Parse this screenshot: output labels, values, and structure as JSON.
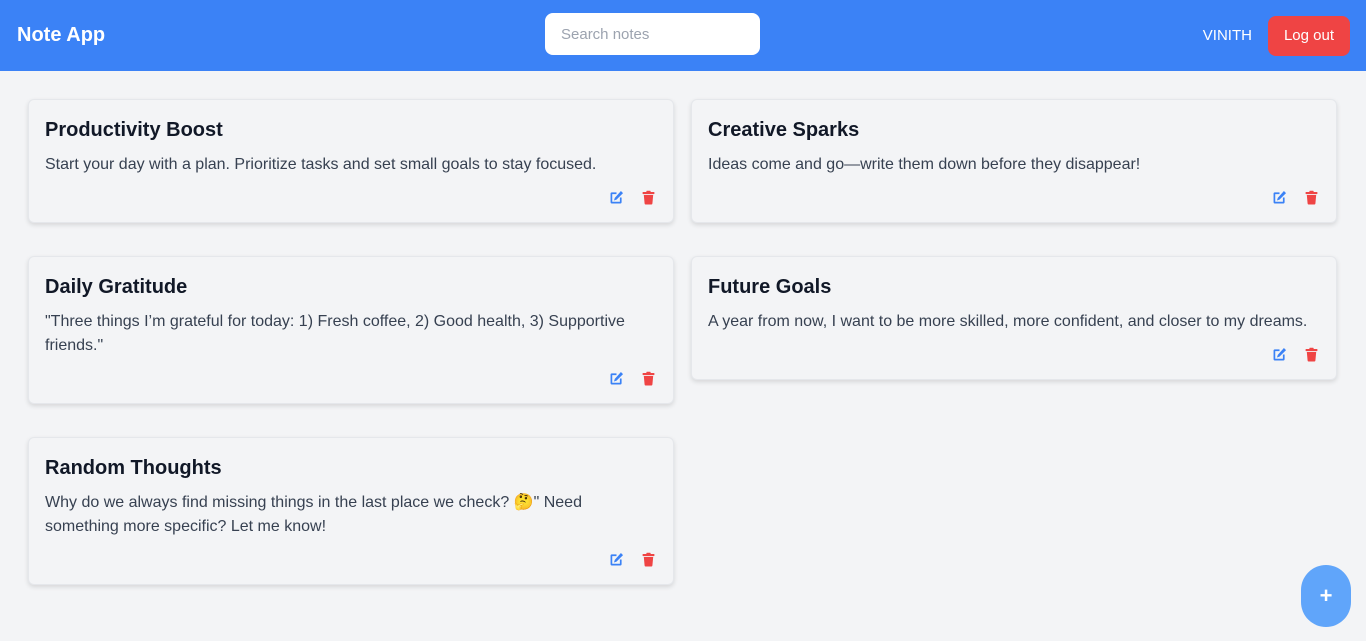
{
  "app": {
    "title": "Note App"
  },
  "search": {
    "placeholder": "Search notes",
    "value": ""
  },
  "user": {
    "name": "VINITH",
    "logout_label": "Log out"
  },
  "notes": [
    {
      "title": "Productivity Boost",
      "body": "Start your day with a plan. Prioritize tasks and set small goals to stay focused."
    },
    {
      "title": "Creative Sparks",
      "body": "Ideas come and go—write them down before they disappear!"
    },
    {
      "title": "Daily Gratitude",
      "body": "\"Three things I’m grateful for today: 1) Fresh coffee, 2) Good health, 3) Supportive friends.\""
    },
    {
      "title": "Future Goals",
      "body": "A year from now, I want to be more skilled, more confident, and closer to my dreams."
    },
    {
      "title": "Random Thoughts",
      "body": "Why do we always find missing things in the last place we check? 🤔\" Need something more specific? Let me know!"
    }
  ],
  "icons": {
    "edit": "edit-icon",
    "delete": "trash-icon",
    "add": "+"
  },
  "colors": {
    "navbar": "#3b82f6",
    "logout": "#ef4444",
    "edit_icon": "#3b82f6",
    "delete_icon": "#ef4444",
    "fab": "#60a5fa",
    "background": "#f3f4f6"
  }
}
